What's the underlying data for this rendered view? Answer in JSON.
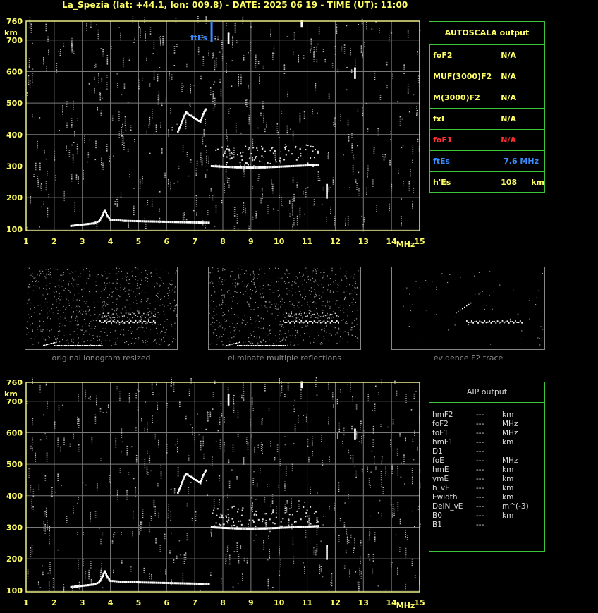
{
  "header": "La_Spezia (lat: +44.1, lon: 009.8) - DATE: 2025 06 19 - TIME (UT): 11:00",
  "colors": {
    "accent_yellow": "#ffff66",
    "grid": "#7a7a7a",
    "frame": "#eeee88",
    "panel_border": "#3cc43c",
    "fof1_red": "#ff3030",
    "ftes_blue": "#3a8cff"
  },
  "ionogram": {
    "y_unit": "km",
    "x_unit": "MHz",
    "fte_label": "ftEs"
  },
  "chart_data": [
    {
      "type": "scatter",
      "title": "",
      "xlabel": "MHz",
      "ylabel": "km",
      "xlim": [
        1,
        15
      ],
      "ylim": [
        95,
        760
      ],
      "x_ticks": [
        1,
        2,
        3,
        4,
        5,
        6,
        7,
        8,
        9,
        10,
        11,
        12,
        13,
        14,
        15
      ],
      "y_ticks": [
        100,
        200,
        300,
        400,
        500,
        600,
        700,
        760
      ],
      "grid": true,
      "markers": [
        {
          "name": "ftEs",
          "x": 7.6
        }
      ],
      "series": [
        {
          "values": [
            [
              2.6,
              110
            ],
            [
              2.8,
              112
            ],
            [
              3.0,
              114
            ],
            [
              3.2,
              116
            ],
            [
              3.4,
              118
            ],
            [
              3.6,
              125
            ],
            [
              3.7,
              140
            ],
            [
              3.8,
              160
            ],
            [
              3.9,
              140
            ],
            [
              4.0,
              130
            ],
            [
              4.5,
              126
            ],
            [
              5.0,
              125
            ],
            [
              5.5,
              124
            ],
            [
              6.0,
              123
            ],
            [
              6.5,
              122
            ],
            [
              7.0,
              121
            ],
            [
              7.5,
              120
            ]
          ]
        },
        {
          "values": [
            [
              7.6,
              300
            ],
            [
              8.0,
              298
            ],
            [
              8.5,
              296
            ],
            [
              9.0,
              295
            ],
            [
              9.5,
              296
            ],
            [
              10.0,
              298
            ],
            [
              10.5,
              300
            ],
            [
              11.0,
              302
            ],
            [
              11.4,
              304
            ]
          ]
        },
        {
          "values": [
            [
              6.4,
              410
            ],
            [
              6.5,
              430
            ],
            [
              6.6,
              455
            ],
            [
              6.7,
              470
            ],
            [
              7.2,
              440
            ],
            [
              7.3,
              465
            ],
            [
              7.4,
              480
            ]
          ]
        },
        {
          "values": [
            [
              8.2,
              690
            ],
            [
              8.2,
              720
            ],
            [
              10.8,
              745
            ],
            [
              10.8,
              760
            ],
            [
              11.7,
              200
            ],
            [
              11.7,
              240
            ],
            [
              12.7,
              580
            ],
            [
              12.7,
              610
            ]
          ]
        }
      ]
    },
    {
      "type": "scatter",
      "title": "",
      "xlabel": "MHz",
      "ylabel": "km",
      "xlim": [
        1,
        15
      ],
      "ylim": [
        95,
        760
      ],
      "x_ticks": [
        1,
        2,
        3,
        4,
        5,
        6,
        7,
        8,
        9,
        10,
        11,
        12,
        13,
        14,
        15
      ],
      "y_ticks": [
        100,
        200,
        300,
        400,
        500,
        600,
        700,
        760
      ],
      "grid": true,
      "series": [
        {
          "values": [
            [
              2.6,
              110
            ],
            [
              2.8,
              112
            ],
            [
              3.0,
              114
            ],
            [
              3.2,
              116
            ],
            [
              3.4,
              118
            ],
            [
              3.6,
              125
            ],
            [
              3.7,
              140
            ],
            [
              3.8,
              160
            ],
            [
              3.9,
              140
            ],
            [
              4.0,
              130
            ],
            [
              4.5,
              126
            ],
            [
              5.0,
              125
            ],
            [
              5.5,
              124
            ],
            [
              6.0,
              123
            ],
            [
              6.5,
              122
            ],
            [
              7.0,
              121
            ],
            [
              7.5,
              120
            ]
          ]
        },
        {
          "values": [
            [
              7.6,
              300
            ],
            [
              8.0,
              298
            ],
            [
              8.5,
              296
            ],
            [
              9.0,
              295
            ],
            [
              9.5,
              296
            ],
            [
              10.0,
              298
            ],
            [
              10.5,
              300
            ],
            [
              11.0,
              302
            ],
            [
              11.4,
              304
            ]
          ]
        },
        {
          "values": [
            [
              6.4,
              410
            ],
            [
              6.5,
              430
            ],
            [
              6.6,
              455
            ],
            [
              6.7,
              470
            ],
            [
              7.2,
              440
            ],
            [
              7.3,
              465
            ],
            [
              7.4,
              480
            ]
          ]
        },
        {
          "values": [
            [
              8.2,
              690
            ],
            [
              8.2,
              720
            ],
            [
              10.8,
              745
            ],
            [
              10.8,
              760
            ],
            [
              11.7,
              200
            ],
            [
              11.7,
              240
            ],
            [
              12.7,
              580
            ],
            [
              12.7,
              610
            ]
          ]
        }
      ]
    }
  ],
  "small_panels": [
    {
      "caption": "original ionogram resized"
    },
    {
      "caption": "eliminate multiple reflections"
    },
    {
      "caption": "evidence F2 trace"
    }
  ],
  "autoscala": {
    "title": "AUTOSCALA output",
    "rows": [
      {
        "label": "foF2",
        "value": "N/A",
        "unit": ""
      },
      {
        "label": "MUF(3000)F2",
        "value": "N/A",
        "unit": ""
      },
      {
        "label": "M(3000)F2",
        "value": "N/A",
        "unit": ""
      },
      {
        "label": "fxI",
        "value": "N/A",
        "unit": ""
      },
      {
        "label": "foF1",
        "value": "N/A",
        "unit": ""
      },
      {
        "label": "ftEs",
        "value": "7.6 MHz",
        "unit": ""
      },
      {
        "label": "h'Es",
        "value": "108",
        "unit": "km"
      }
    ]
  },
  "aip": {
    "title": "AIP output",
    "rows": [
      {
        "label": "hmF2",
        "value": "---",
        "unit": "km"
      },
      {
        "label": "foF2",
        "value": "---",
        "unit": "MHz"
      },
      {
        "label": "foF1",
        "value": "---",
        "unit": "MHz"
      },
      {
        "label": "hmF1",
        "value": "---",
        "unit": "km"
      },
      {
        "label": "D1",
        "value": "---",
        "unit": ""
      },
      {
        "label": "foE",
        "value": "---",
        "unit": "MHz"
      },
      {
        "label": "hmE",
        "value": "---",
        "unit": "km"
      },
      {
        "label": "ymE",
        "value": "---",
        "unit": "km"
      },
      {
        "label": "h_vE",
        "value": "---",
        "unit": "km"
      },
      {
        "label": "Ewidth",
        "value": "---",
        "unit": "km"
      },
      {
        "label": "DelN_vE",
        "value": "---",
        "unit": "m^(-3)"
      },
      {
        "label": "B0",
        "value": "---",
        "unit": "km"
      },
      {
        "label": "B1",
        "value": "---",
        "unit": ""
      }
    ]
  }
}
